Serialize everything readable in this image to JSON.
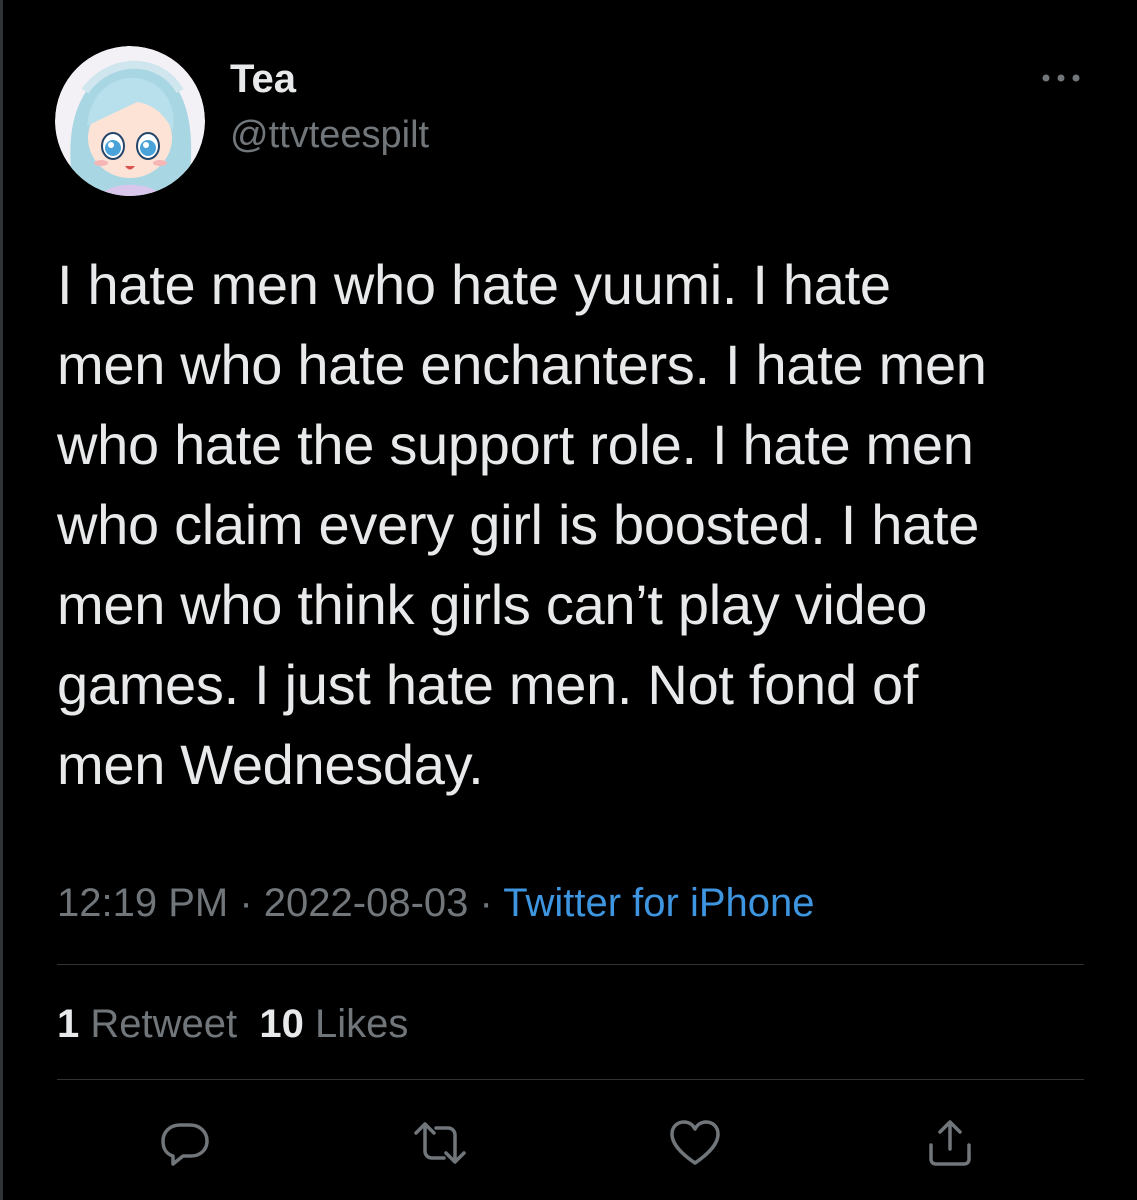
{
  "author": {
    "name": "Tea",
    "handle": "@ttvteespilt",
    "avatar_icon": "anime-avatar-icon"
  },
  "tweet": {
    "text": "I hate men who hate yuumi. I hate\nmen who hate enchanters. I hate men\nwho hate the support role. I hate men\nwho claim every girl is boosted. I hate\nmen who think girls can’t play video\ngames. I just hate men. Not fond of\nmen Wednesday.",
    "time": "12:19 PM",
    "separator": "·",
    "date": "2022-08-03",
    "source": "Twitter for iPhone"
  },
  "stats": {
    "retweets_count": "1",
    "retweets_label": "Retweet",
    "likes_count": "10",
    "likes_label": "Likes"
  },
  "actions": [
    "reply-icon",
    "retweet-icon",
    "like-icon",
    "share-icon"
  ],
  "colors": {
    "background": "#000000",
    "text": "#e7e9ea",
    "secondary_text": "#71767b",
    "link": "#3e95e0",
    "divider": "#2f3336"
  }
}
